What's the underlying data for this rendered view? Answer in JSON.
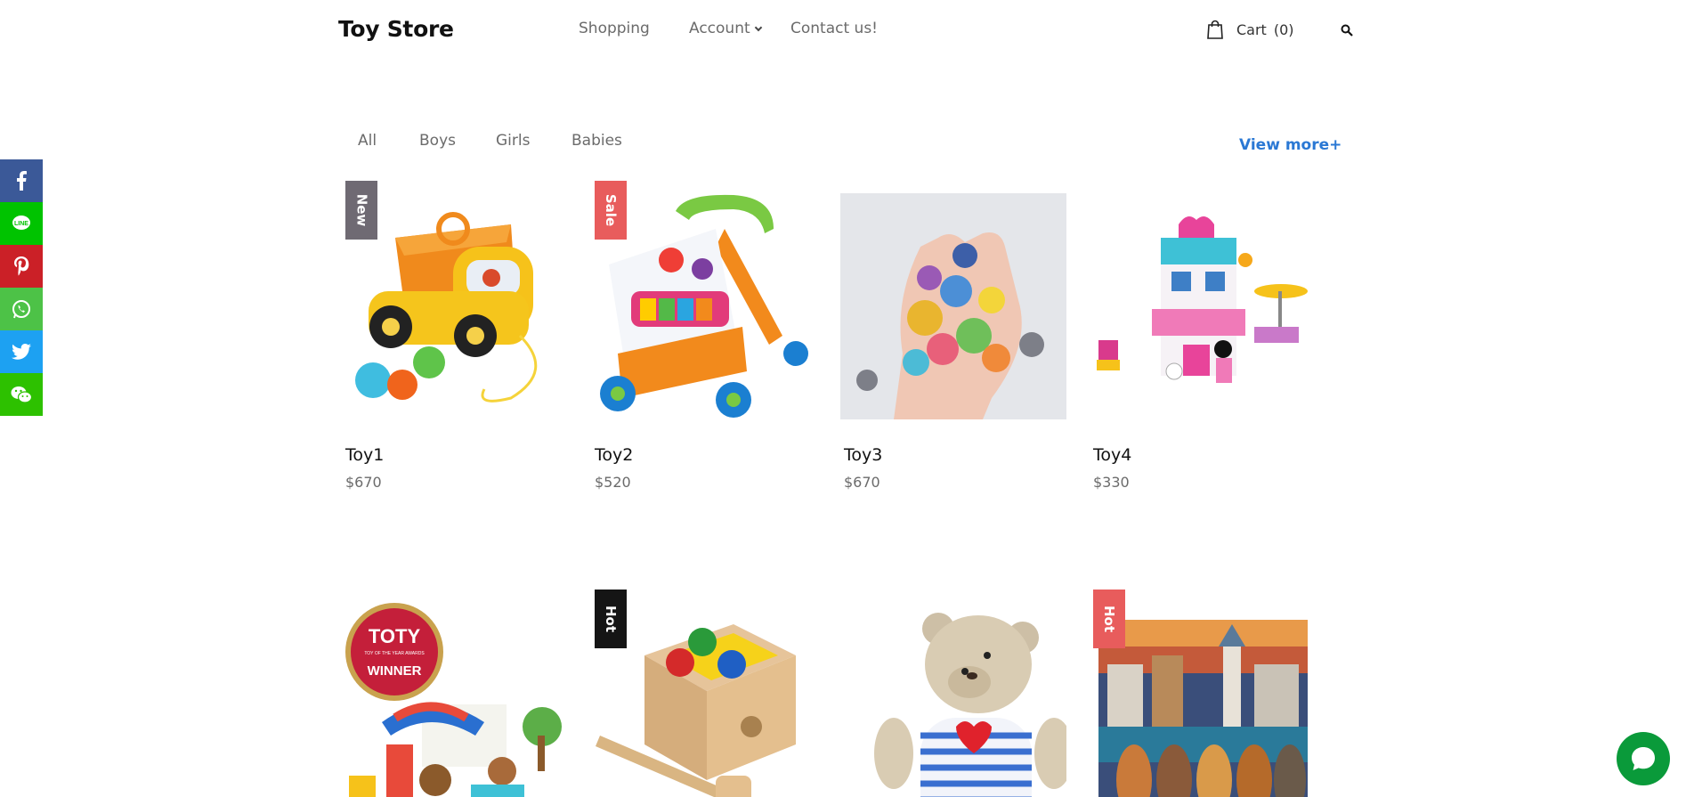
{
  "header": {
    "brand": "Toy Store",
    "nav": [
      {
        "label": "Shopping"
      },
      {
        "label": "Account",
        "has_dropdown": true
      },
      {
        "label": "Contact us!"
      }
    ],
    "cart": {
      "label": "Cart",
      "count": "(0)"
    },
    "search_icon": "search-icon"
  },
  "filters": {
    "tabs": [
      "All",
      "Boys",
      "Girls",
      "Babies"
    ],
    "view_more": "View more+"
  },
  "products": [
    {
      "name": "Toy1",
      "price": "$670",
      "badge": "New",
      "badge_color": "#6f6a73",
      "image": "yellow dump truck toy"
    },
    {
      "name": "Toy2",
      "price": "$520",
      "badge": "Sale",
      "badge_color": "#e85c5c",
      "image": "baby walker activity toy"
    },
    {
      "name": "Toy3",
      "price": "$670",
      "badge": "",
      "badge_color": "",
      "image": "handful of small figurines"
    },
    {
      "name": "Toy4",
      "price": "$330",
      "badge": "",
      "badge_color": "",
      "image": "pink duplo cafe set"
    },
    {
      "name": "",
      "price": "",
      "badge": "",
      "badge_color": "",
      "image": "toy of the year playset"
    },
    {
      "name": "",
      "price": "",
      "badge": "Hot",
      "badge_color": "#151515",
      "image": "wooden pound-a-ball box"
    },
    {
      "name": "",
      "price": "",
      "badge": "",
      "badge_color": "",
      "image": "teddy bear with heart"
    },
    {
      "name": "",
      "price": "",
      "badge": "Hot",
      "badge_color": "#e85c5c",
      "image": "dogs watching town jigsaw puzzle"
    }
  ],
  "toty_badge": {
    "logo": "TOTY",
    "sub": "TOY OF THE YEAR AWARDS",
    "label": "WINNER"
  },
  "social": [
    {
      "icon": "facebook-icon",
      "color": "#3b5998"
    },
    {
      "icon": "line-icon",
      "color": "#00c300"
    },
    {
      "icon": "pinterest-icon",
      "color": "#cb2027"
    },
    {
      "icon": "whatsapp-icon",
      "color": "#4dc247"
    },
    {
      "icon": "twitter-icon",
      "color": "#1da1f2"
    },
    {
      "icon": "wechat-icon",
      "color": "#2dc100"
    }
  ],
  "chat": {
    "icon": "chat-bubble-icon",
    "color": "#0a9a3a"
  }
}
